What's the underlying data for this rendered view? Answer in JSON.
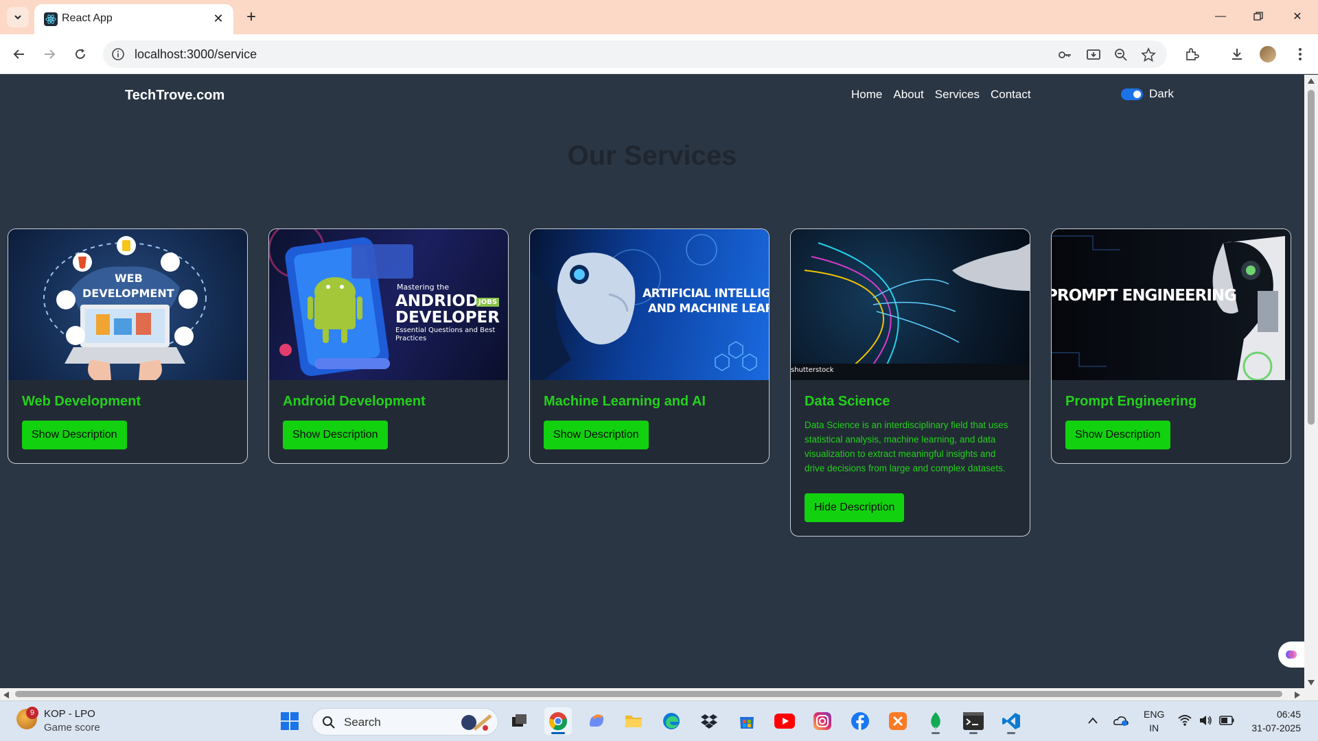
{
  "browser": {
    "tab_title": "React App",
    "url": "localhost:3000/service"
  },
  "site": {
    "brand": "TechTrove.com",
    "nav": [
      "Home",
      "About",
      "Services",
      "Contact"
    ],
    "theme_toggle_label": "Dark",
    "theme_toggle_on": true,
    "heading": "Our Services"
  },
  "colors": {
    "page_bg": "#2b3644",
    "card_bg": "#222a35",
    "accent_green": "#23d11b",
    "button_green": "#12d10f",
    "toggle_blue": "#1a73e8"
  },
  "cards": [
    {
      "title": "Web Development",
      "button": "Show Description",
      "image_text": [
        "WEB",
        "DEVELOPMENT"
      ]
    },
    {
      "title": "Android Development",
      "button": "Show Description",
      "image_text": [
        "Mastering the",
        "ANDRIOD",
        "JOBS",
        "DEVELOPER",
        "Essential Questions and Best",
        "Practices"
      ]
    },
    {
      "title": "Machine Learning and AI",
      "button": "Show Description",
      "image_text": [
        "ARTIFICIAL INTELLIGENCE",
        "AND MACHINE LEARNING"
      ]
    },
    {
      "title": "Data Science",
      "description": "Data Science is an interdisciplinary field that uses statistical analysis, machine learning, and data visualization to extract meaningful insights and drive decisions from large and complex datasets.",
      "button": "Hide Description",
      "image_text": [
        "shutterstock"
      ]
    },
    {
      "title": "Prompt Engineering",
      "button": "Show Description",
      "image_text": [
        "PROMPT ENGINEERING"
      ]
    }
  ],
  "taskbar": {
    "weather_badge": "9",
    "weather_line1": "KOP - LPO",
    "weather_line2": "Game score",
    "search_label": "Search",
    "lang_line1": "ENG",
    "lang_line2": "IN",
    "time": "06:45",
    "date": "31-07-2025",
    "apps": [
      "start-icon",
      "search-icon",
      "task-view-icon",
      "chrome-icon",
      "copilot-icon",
      "file-explorer-icon",
      "edge-icon",
      "dropbox-icon",
      "microsoft-store-icon",
      "youtube-icon",
      "instagram-icon",
      "facebook-icon",
      "xampp-icon",
      "mongodb-icon",
      "terminal-icon",
      "vscode-icon"
    ]
  }
}
